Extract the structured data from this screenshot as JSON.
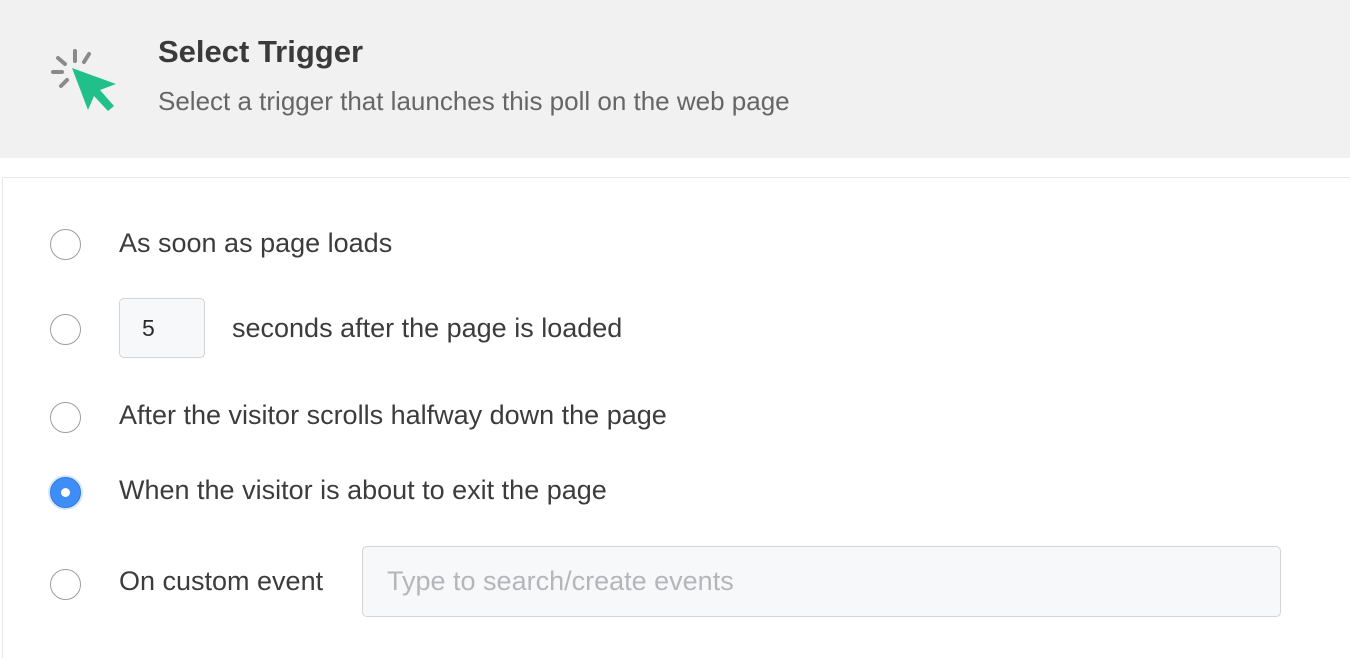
{
  "header": {
    "title": "Select Trigger",
    "subtitle": "Select a trigger that launches this poll on the web page",
    "icon": "cursor-click-icon",
    "icon_color": "#21c08b"
  },
  "trigger_options": [
    {
      "label": "As soon as page loads",
      "selected": false
    },
    {
      "value": "5",
      "label": "seconds after the page is loaded",
      "selected": false
    },
    {
      "label": "After the visitor scrolls halfway down the page",
      "selected": false
    },
    {
      "label": "When the visitor is about to exit the page",
      "selected": true
    },
    {
      "label": "On custom event",
      "placeholder": "Type to search/create events",
      "selected": false
    }
  ],
  "colors": {
    "header_bg": "#f1f1f1",
    "radio_selected": "#3f8ef7"
  }
}
